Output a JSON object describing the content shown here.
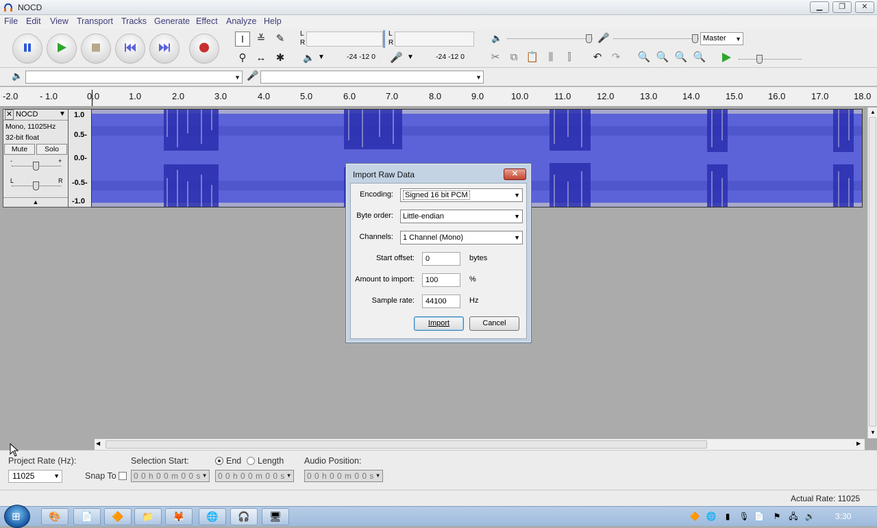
{
  "window": {
    "title": "NOCD",
    "controls": [
      "minimize-icon",
      "restore-icon",
      "close-icon"
    ]
  },
  "menu": [
    "File",
    "Edit",
    "View",
    "Transport",
    "Tracks",
    "Generate",
    "Effect",
    "Analyze",
    "Help"
  ],
  "meters": {
    "play_scale": "-24 -12  0",
    "rec_scale": "-24 -12  0",
    "L": "L",
    "R": "R"
  },
  "mixer": {
    "device": "Master"
  },
  "device_toolbar": {
    "output_device": "",
    "input_device": ""
  },
  "ruler": {
    "labels": [
      "-2.0",
      "- 1.0",
      "0.0",
      "1.0",
      "2.0",
      "3.0",
      "4.0",
      "5.0",
      "6.0",
      "7.0",
      "8.0",
      "9.0",
      "10.0",
      "11.0",
      "12.0",
      "13.0",
      "14.0",
      "15.0",
      "16.0",
      "17.0",
      "18.0"
    ]
  },
  "track": {
    "name": "NOCD",
    "format": "Mono, 11025Hz",
    "bit_depth": "32-bit float",
    "mute": "Mute",
    "solo": "Solo",
    "gain_minus": "-",
    "gain_plus": "+",
    "pan_left": "L",
    "pan_right": "R",
    "scale": [
      "1.0",
      "0.5-",
      "0.0-",
      "-0.5-",
      "-1.0"
    ]
  },
  "dialog": {
    "title": "Import Raw Data",
    "encoding_label": "Encoding:",
    "encoding_value": "Signed 16 bit PCM",
    "byte_order_label": "Byte order:",
    "byte_order_value": "Little-endian",
    "channels_label": "Channels:",
    "channels_value": "1 Channel (Mono)",
    "start_offset_label": "Start offset:",
    "start_offset_value": "0",
    "start_offset_unit": "bytes",
    "amount_label": "Amount to import:",
    "amount_value": "100",
    "amount_unit": "%",
    "sample_rate_label": "Sample rate:",
    "sample_rate_value": "44100",
    "sample_rate_unit": "Hz",
    "import_button": "Import",
    "cancel_button": "Cancel"
  },
  "selection_bar": {
    "project_rate_label": "Project Rate (Hz):",
    "project_rate_value": "11025",
    "snap_to_label": "Snap To",
    "selection_start_label": "Selection Start:",
    "end_label": "End",
    "length_label": "Length",
    "audio_position_label": "Audio Position:",
    "time_start": "0 0 h 0 0 m 0 0 s",
    "time_end": "0 0 h 0 0 m 0 0 s",
    "time_position": "0 0 h 0 0 m 0 0 s"
  },
  "status": {
    "actual_rate": "Actual Rate: 11025"
  },
  "taskbar": {
    "clock": "3:30"
  },
  "colors": {
    "waveform": "#5c63d8",
    "waveform_dark": "#2a2fb0",
    "accent_record": "#c93030",
    "play_green": "#2ea62e"
  }
}
